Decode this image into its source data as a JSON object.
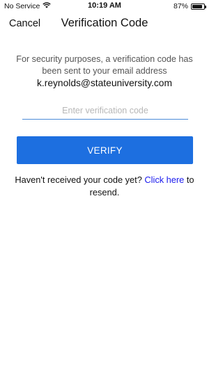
{
  "status_bar": {
    "carrier": "No Service",
    "time": "10:19 AM",
    "battery_percent": "87%",
    "battery_level": 0.87,
    "icons": [
      "wifi-icon",
      "battery-icon"
    ]
  },
  "nav": {
    "cancel_label": "Cancel",
    "title": "Verification Code"
  },
  "content": {
    "message": "For security purposes, a verification code has been sent to your email address",
    "email": "k.reynolds@stateuniversity.com",
    "code_input": {
      "value": "",
      "placeholder": "Enter verification code"
    },
    "verify_label": "VERIFY",
    "resend_prefix": "Haven't received your code yet?",
    "resend_link": "Click here",
    "resend_suffix": "to resend."
  },
  "colors": {
    "primary": "#1d6fe0",
    "link": "#1a1aee",
    "input_underline": "#4a8ad8",
    "message_text": "#555555"
  }
}
